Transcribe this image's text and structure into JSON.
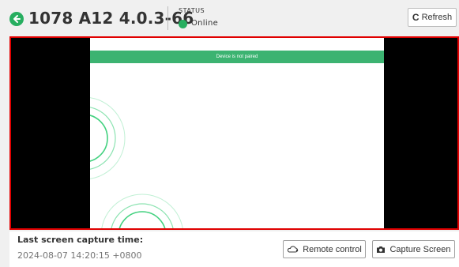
{
  "header": {
    "device_title": "1078 A12 4.0.3-66",
    "status_label": "STATUS",
    "status_value": "Online",
    "refresh_label": "Refresh",
    "back_icon": "arrow-left-circle-icon",
    "refresh_icon": "refresh-icon"
  },
  "screen": {
    "banner_text": "Device is not paired"
  },
  "footer": {
    "capture_label": "Last screen capture time:",
    "capture_time": "2024-08-07 14:20:15 +0800",
    "remote_control_label": "Remote control",
    "capture_screen_label": "Capture Screen",
    "remote_icon": "remote-cloud-icon",
    "camera_icon": "camera-icon"
  },
  "colors": {
    "accent_green": "#27ae60",
    "banner_green": "#3cb371",
    "highlight_red": "#e00000"
  }
}
